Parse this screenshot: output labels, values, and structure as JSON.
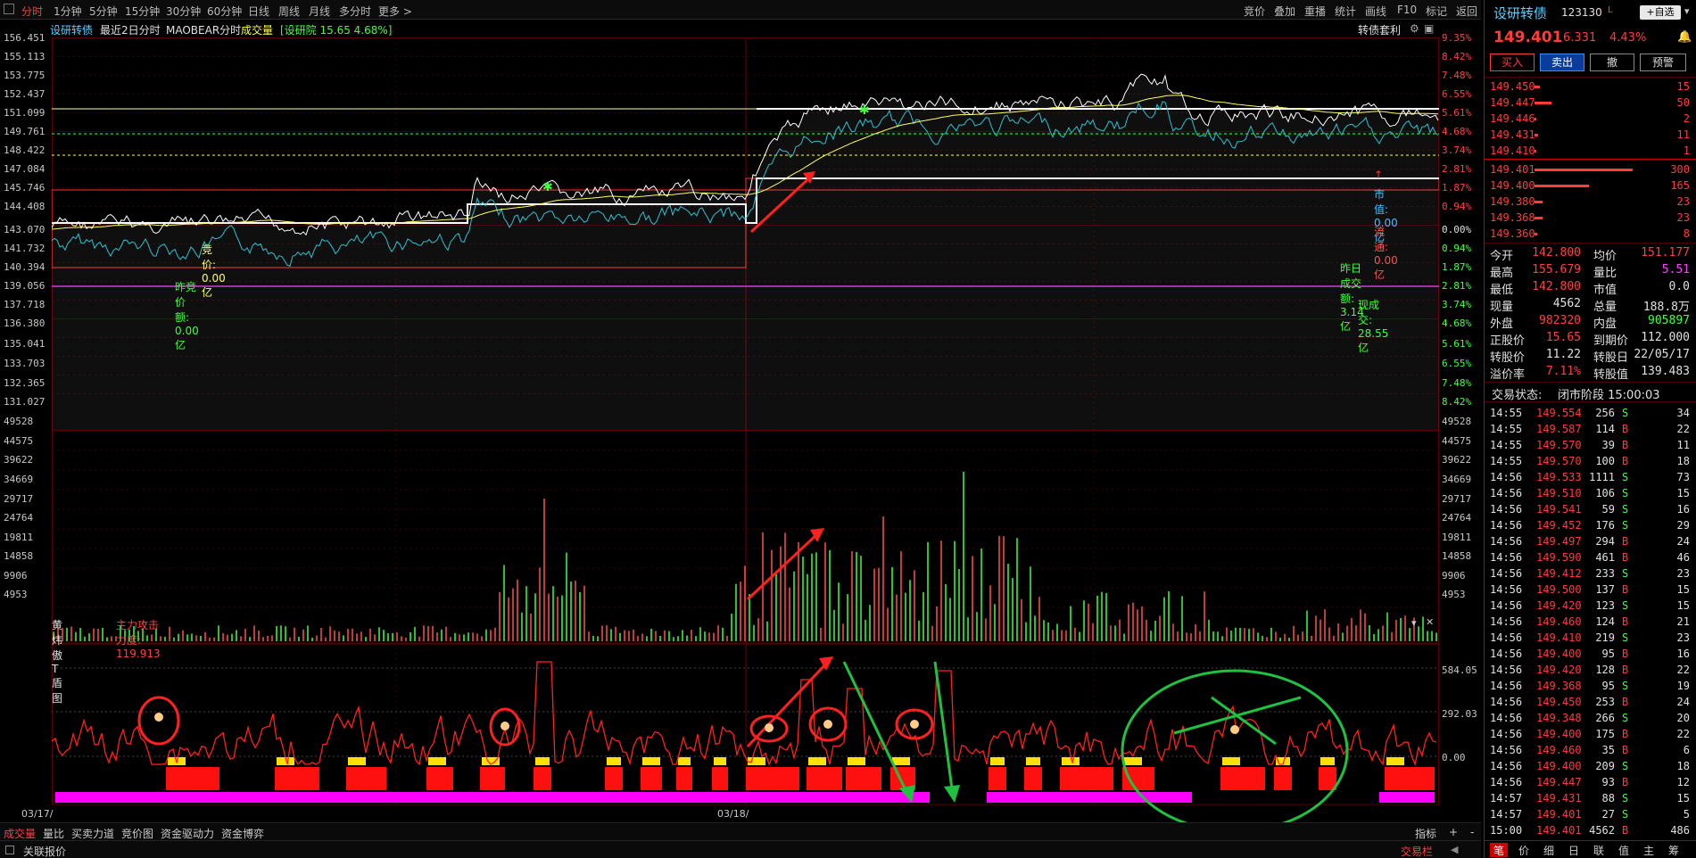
{
  "toolbar": {
    "timeframes": [
      "分时",
      "1分钟",
      "5分钟",
      "15分钟",
      "30分钟",
      "60分钟",
      "日线",
      "周线",
      "月线",
      "多分时",
      "更多 >"
    ],
    "actions": [
      "竞价",
      "叠加",
      "重播",
      "统计",
      "画线",
      "F10",
      "标记",
      "返回"
    ]
  },
  "chart_info": {
    "name": "设研转债",
    "mode": "最近2日分时",
    "indicator": "MAOBEAR分时",
    "volume_label": "成交量",
    "stock_ref": "[设研院 15.65 4.68%]",
    "arb_label": "转债套利"
  },
  "price_axis": [
    "156.451",
    "155.113",
    "153.775",
    "152.437",
    "151.099",
    "149.761",
    "148.422",
    "147.084",
    "145.746",
    "144.408",
    "143.070",
    "141.732",
    "140.394",
    "139.056",
    "137.718",
    "136.380",
    "135.041",
    "133.703",
    "132.365",
    "131.027"
  ],
  "pct_axis": [
    "9.35%",
    "8.42%",
    "7.48%",
    "6.55%",
    "5.61%",
    "4.68%",
    "3.74%",
    "2.81%",
    "1.87%",
    "0.94%",
    "0.00%",
    "0.94%",
    "1.87%",
    "2.81%",
    "3.74%",
    "4.68%",
    "5.61%",
    "6.55%",
    "7.48%",
    "8.42%"
  ],
  "vol_axis": [
    "49528",
    "44575",
    "39622",
    "34669",
    "29717",
    "24764",
    "19811",
    "14858",
    "9906",
    "4953"
  ],
  "ind_axis": [
    "584.05",
    "292.03",
    "0.00"
  ],
  "annotations": {
    "auction": "竞价: 0.00亿",
    "prev_auction": "昨竞价额: 0.00亿",
    "mkt_value": "市值: 0.00亿",
    "float_value": "流通: 0.00亿",
    "prev_turnover": "昨日成交额: 3.14亿",
    "now_turnover": "现成交: 28.55亿"
  },
  "indicator_panel": {
    "title": "黄炜傲T盾图",
    "subtitle": "主力攻击力度: 119.913"
  },
  "dates": [
    "03/17/四",
    "03/18/五"
  ],
  "bottom_tabs": [
    "成交量",
    "量比",
    "买卖力道",
    "竞价图",
    "资金驱动力",
    "资金博弈"
  ],
  "bottom_right": [
    "指标",
    "+",
    "-"
  ],
  "status": {
    "left": "关联报价",
    "right": "交易栏"
  },
  "quote": {
    "name": "设研转债",
    "code": "123130",
    "suffix": "L",
    "price": "149.401",
    "change": "6.331",
    "pct": "4.43%",
    "self_select": "自选",
    "buttons": [
      "买入",
      "卖出",
      "撤",
      "预警"
    ],
    "asks": [
      {
        "p": "149.450",
        "v": "15",
        "w": 0.05
      },
      {
        "p": "149.447",
        "v": "50",
        "w": 0.17
      },
      {
        "p": "149.446",
        "v": "2",
        "w": 0.01
      },
      {
        "p": "149.431",
        "v": "11",
        "w": 0.04
      },
      {
        "p": "149.410",
        "v": "1",
        "w": 0.01
      }
    ],
    "bids": [
      {
        "p": "149.401",
        "v": "300",
        "w": 1.0
      },
      {
        "p": "149.400",
        "v": "165",
        "w": 0.55
      },
      {
        "p": "149.380",
        "v": "23",
        "w": 0.08
      },
      {
        "p": "149.368",
        "v": "23",
        "w": 0.08
      },
      {
        "p": "149.360",
        "v": "8",
        "w": 0.03
      }
    ],
    "stats": [
      [
        "今开",
        "142.800",
        "#ff4040",
        "均价",
        "151.177",
        "#ff4040"
      ],
      [
        "最高",
        "155.679",
        "#ff4040",
        "量比",
        "5.51",
        "#ff40ff"
      ],
      [
        "最低",
        "142.800",
        "#ff4040",
        "市值",
        "0.0",
        "#e0e0e0"
      ],
      [
        "现量",
        "4562",
        "#e0e0e0",
        "总量",
        "188.8万",
        "#e0e0e0"
      ],
      [
        "外盘",
        "982320",
        "#ff4040",
        "内盘",
        "905897",
        "#40ff40"
      ],
      [
        "正股价",
        "15.65",
        "#ff4040",
        "到期价",
        "112.000",
        "#e0e0e0"
      ],
      [
        "转股价",
        "11.22",
        "#e0e0e0",
        "转股日",
        "22/05/17",
        "#e0e0e0"
      ],
      [
        "溢价率",
        "7.11%",
        "#ff4040",
        "转股值",
        "139.483",
        "#e0e0e0"
      ]
    ],
    "state_label": "交易状态:",
    "state_value": "闭市阶段 15:00:03",
    "ticks": [
      [
        "14:55",
        "149.554",
        "256",
        "S",
        "34"
      ],
      [
        "14:55",
        "149.587",
        "114",
        "B",
        "22"
      ],
      [
        "14:55",
        "149.570",
        "39",
        "B",
        "11"
      ],
      [
        "14:55",
        "149.570",
        "100",
        "B",
        "18"
      ],
      [
        "14:56",
        "149.533",
        "1111",
        "S",
        "73"
      ],
      [
        "14:56",
        "149.510",
        "106",
        "S",
        "15"
      ],
      [
        "14:56",
        "149.541",
        "59",
        "S",
        "16"
      ],
      [
        "14:56",
        "149.452",
        "176",
        "S",
        "29"
      ],
      [
        "14:56",
        "149.497",
        "294",
        "B",
        "24"
      ],
      [
        "14:56",
        "149.590",
        "461",
        "B",
        "46"
      ],
      [
        "14:56",
        "149.412",
        "233",
        "S",
        "23"
      ],
      [
        "14:56",
        "149.500",
        "137",
        "B",
        "15"
      ],
      [
        "14:56",
        "149.420",
        "123",
        "S",
        "15"
      ],
      [
        "14:56",
        "149.460",
        "124",
        "B",
        "21"
      ],
      [
        "14:56",
        "149.410",
        "219",
        "S",
        "23"
      ],
      [
        "14:56",
        "149.400",
        "95",
        "B",
        "16"
      ],
      [
        "14:56",
        "149.420",
        "128",
        "B",
        "22"
      ],
      [
        "14:56",
        "149.368",
        "95",
        "S",
        "19"
      ],
      [
        "14:56",
        "149.450",
        "253",
        "B",
        "24"
      ],
      [
        "14:56",
        "149.348",
        "266",
        "S",
        "20"
      ],
      [
        "14:56",
        "149.400",
        "175",
        "B",
        "22"
      ],
      [
        "14:56",
        "149.460",
        "35",
        "B",
        "6"
      ],
      [
        "14:56",
        "149.400",
        "209",
        "S",
        "18"
      ],
      [
        "14:56",
        "149.447",
        "93",
        "B",
        "12"
      ],
      [
        "14:57",
        "149.431",
        "88",
        "S",
        "15"
      ],
      [
        "14:57",
        "149.401",
        "27",
        "S",
        "5"
      ],
      [
        "15:00",
        "149.401",
        "4562",
        "B",
        "486"
      ]
    ],
    "nav": [
      "笔",
      "价",
      "细",
      "日",
      "联",
      "值",
      "主",
      "筹"
    ]
  },
  "colors": {
    "up": "#ff3c3c",
    "down": "#3cff3c",
    "grid": "#5a0000",
    "yellow": "#ffff00",
    "magenta": "#ff00ff"
  }
}
